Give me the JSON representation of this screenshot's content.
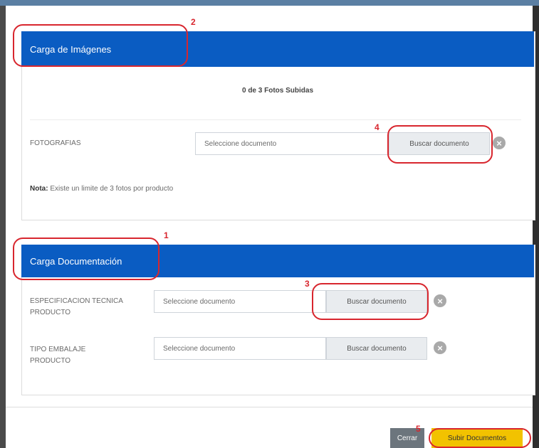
{
  "images_panel": {
    "header": "Carga de Imágenes",
    "counter": "0 de 3 Fotos Subidas",
    "photos_label": "FOTOGRAFIAS",
    "photos_placeholder": "Seleccione documento",
    "search_label": "Buscar documento",
    "note_bold": "Nota:",
    "note_text": " Existe un limite de 3 fotos por producto"
  },
  "docs_panel": {
    "header": "Carga Documentación",
    "rows": [
      {
        "label": "ESPECIFICACION TECNICA PRODUCTO",
        "placeholder": "Seleccione documento",
        "search_label": "Buscar documento"
      },
      {
        "label": "TIPO EMBALAJE PRODUCTO",
        "placeholder": "Seleccione documento",
        "search_label": "Buscar documento"
      }
    ]
  },
  "footer": {
    "close_label": "Cerrar",
    "upload_label": "Subir Documentos"
  },
  "annotations": [
    "1",
    "2",
    "3",
    "4",
    "5"
  ],
  "colors": {
    "panel_header": "#0a5cc2",
    "annotation": "#d8262e",
    "upload_button": "#f2c200",
    "close_button": "#6c757d"
  },
  "icons": {
    "remove": "close-circle-icon"
  }
}
